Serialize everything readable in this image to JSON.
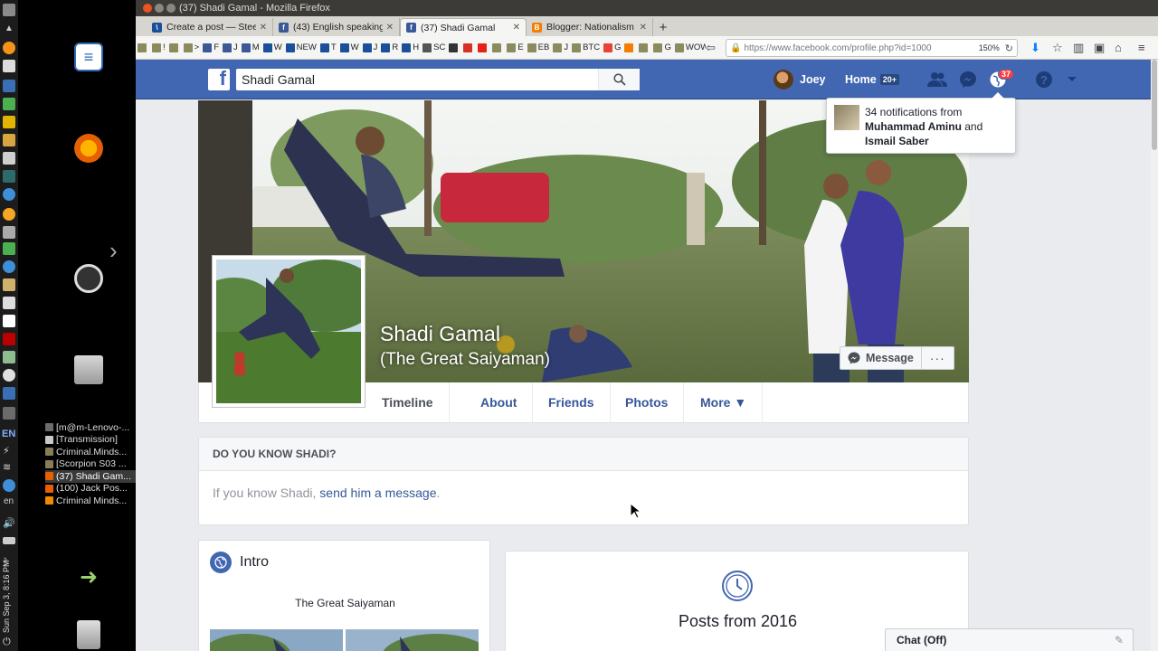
{
  "os": {
    "clock": "Sun Sep 3, 8:16 PM",
    "lang_code": "EN",
    "lang_short": "en",
    "window_list": [
      {
        "label": "[m@m-Lenovo-...",
        "color": "#6b6b6b",
        "active": false
      },
      {
        "label": "[Transmission]",
        "color": "#c8c8c8",
        "active": false
      },
      {
        "label": "Criminal.Minds...",
        "color": "#8a7d55",
        "active": false
      },
      {
        "label": "[Scorpion S03 ...",
        "color": "#8a7d55",
        "active": false
      },
      {
        "label": "(37) Shadi Gam...",
        "color": "#e66000",
        "active": true
      },
      {
        "label": "(100) Jack Pos...",
        "color": "#e66000",
        "active": false
      },
      {
        "label": "Criminal Minds...",
        "color": "#f08a00",
        "active": false
      }
    ]
  },
  "browser": {
    "window_title": "(37) Shadi Gamal - Mozilla Firefox",
    "tabs": [
      {
        "label": "Create a post — Steem",
        "favicon_color": "#1a5099",
        "favicon_glyph": "\\"
      },
      {
        "label": "(43) English speaking",
        "favicon_color": "#3b5998",
        "favicon_glyph": "f"
      },
      {
        "label": "(37) Shadi Gamal",
        "favicon_color": "#3b5998",
        "favicon_glyph": "f"
      },
      {
        "label": "Blogger: Nationalism",
        "favicon_color": "#f57d00",
        "favicon_glyph": "B"
      }
    ],
    "url": "https://www.facebook.com/profile.php?id=1000",
    "zoom": "150%",
    "bookmarks": [
      {
        "label": "",
        "color": "#8c8a5f"
      },
      {
        "label": "!",
        "color": "#8c8a5f"
      },
      {
        "label": "",
        "color": "#8c8a5f"
      },
      {
        "label": ">",
        "color": "#8c8a5f"
      },
      {
        "label": "F",
        "color": "#3b5998"
      },
      {
        "label": "J",
        "color": "#3b5998"
      },
      {
        "label": "M",
        "color": "#3b5998"
      },
      {
        "label": "W",
        "color": "#1a5099"
      },
      {
        "label": "NEW",
        "color": "#1a5099"
      },
      {
        "label": "T",
        "color": "#1a5099"
      },
      {
        "label": "W",
        "color": "#1a5099"
      },
      {
        "label": "J",
        "color": "#1a5099"
      },
      {
        "label": "R",
        "color": "#1a5099"
      },
      {
        "label": "H",
        "color": "#1a5099"
      },
      {
        "label": "SC",
        "color": "#555555"
      },
      {
        "label": "",
        "color": "#333333"
      },
      {
        "label": "",
        "color": "#d93025"
      },
      {
        "label": "",
        "color": "#e62117"
      },
      {
        "label": "",
        "color": "#8c8a5f"
      },
      {
        "label": "E",
        "color": "#8c8a5f"
      },
      {
        "label": "EB",
        "color": "#8c8a5f"
      },
      {
        "label": "J",
        "color": "#8c8a5f"
      },
      {
        "label": "BTC",
        "color": "#8c8a5f"
      },
      {
        "label": "G",
        "color": "#ea4335"
      },
      {
        "label": "",
        "color": "#f57d00"
      },
      {
        "label": "",
        "color": "#8c8a5f"
      },
      {
        "label": "G",
        "color": "#8c8a5f"
      },
      {
        "label": "WOW",
        "color": "#8c8a5f"
      }
    ]
  },
  "fb": {
    "search_value": "Shadi Gamal",
    "user_name": "Joey",
    "home_label": "Home",
    "home_count": "20+",
    "notif_count": "37",
    "notif_popup": {
      "prefix": "34 notifications from",
      "name1": "Muhammad Aminu",
      "conj": "and",
      "name2": "Ismail Saber"
    },
    "profile": {
      "name": "Shadi Gamal",
      "alt_name": "(The Great Saiyaman)",
      "message_label": "Message",
      "more_dots": "···"
    },
    "tabs": [
      {
        "label": "Timeline"
      },
      {
        "label": "About"
      },
      {
        "label": "Friends"
      },
      {
        "label": "Photos"
      },
      {
        "label": "More ▼"
      }
    ],
    "know": {
      "heading": "DO YOU KNOW SHADI?",
      "text_prefix": "If you know Shadi, ",
      "link": "send him a message",
      "text_suffix": "."
    },
    "intro": {
      "heading": "Intro",
      "bio": "The Great Saiyaman"
    },
    "posts": {
      "title": "Posts from 2016"
    },
    "chat": {
      "label": "Chat (Off)"
    }
  },
  "colors": {
    "fb_blue": "#4267b2",
    "link_blue": "#365899",
    "notif_red": "#fa3e3e"
  }
}
